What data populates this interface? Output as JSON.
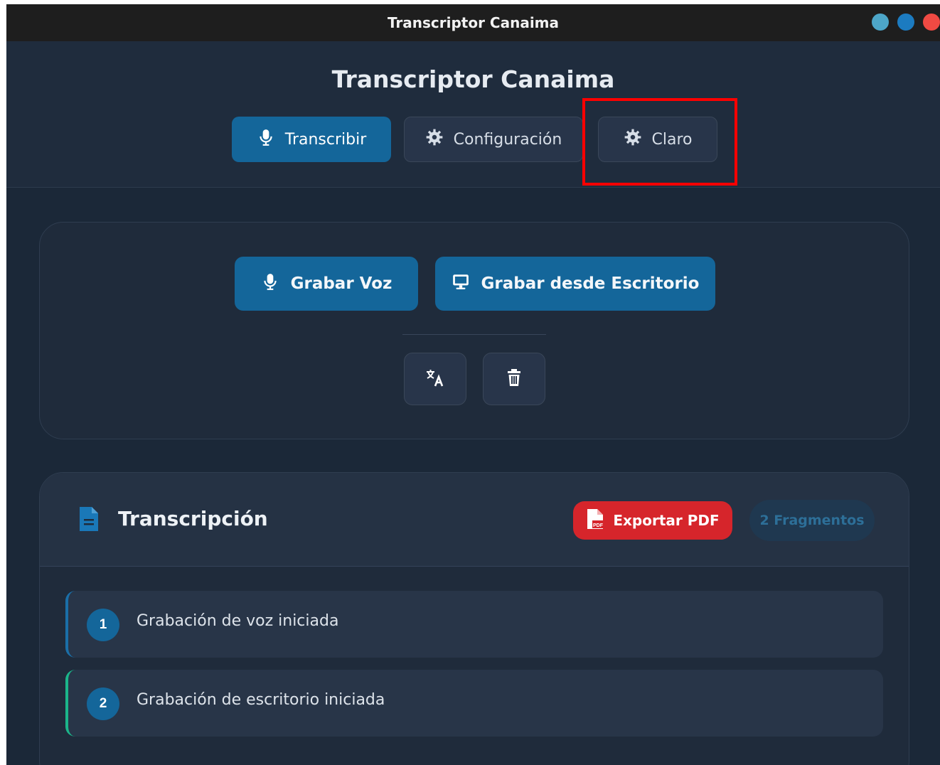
{
  "window": {
    "title": "Transcriptor Canaima"
  },
  "header": {
    "app_title": "Transcriptor Canaima",
    "nav": [
      {
        "label": "Transcribir",
        "icon": "microphone-icon",
        "active": true
      },
      {
        "label": "Configuración",
        "icon": "gear-icon",
        "active": false
      },
      {
        "label": "Claro",
        "icon": "gear-icon",
        "active": false
      }
    ]
  },
  "record_panel": {
    "grabar_voz_label": "Grabar Voz",
    "grabar_escritorio_label": "Grabar desde Escritorio",
    "tools": [
      {
        "icon": "translate-icon"
      },
      {
        "icon": "trash-icon"
      }
    ]
  },
  "transcription": {
    "title": "Transcripción",
    "export_label": "Exportar PDF",
    "fragments_count_label": "2 Fragmentos",
    "fragments": [
      {
        "number": "1",
        "text": "Grabación de voz iniciada"
      },
      {
        "number": "2",
        "text": "Grabación de escritorio iniciada"
      }
    ]
  },
  "colors": {
    "primary": "#14669a",
    "export": "#d6252b",
    "highlight": "#ff0000",
    "fragment_accent_1": "#1a6fa8",
    "fragment_accent_2": "#1bb58a"
  }
}
